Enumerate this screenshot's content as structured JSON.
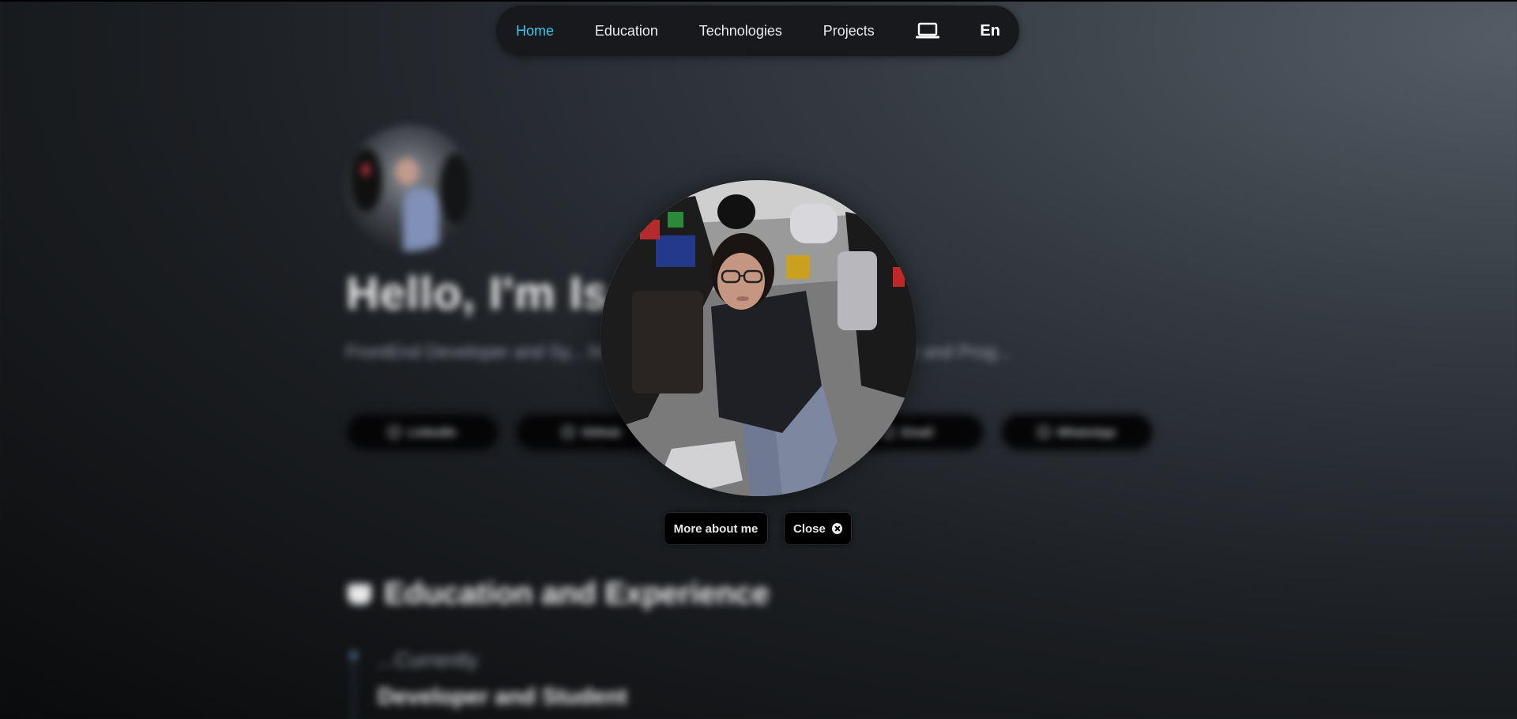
{
  "nav": {
    "items": [
      {
        "label": "Home",
        "active": true
      },
      {
        "label": "Education",
        "active": false
      },
      {
        "label": "Technologies",
        "active": false
      },
      {
        "label": "Projects",
        "active": false
      }
    ],
    "theme_icon": "laptop-icon",
    "language": "En",
    "accent_color": "#3cc6ea"
  },
  "background": {
    "hello": "Hello, I'm Is",
    "description": "FrontEnd Developer and Sy... Mexico. Contributing to the Development and Prog...",
    "socials": [
      "LinkedIn",
      "GitHub",
      "Email",
      "WhatsApp"
    ],
    "section_title": "Education and Experience",
    "timeline": {
      "date": "...Currently",
      "title": "Developer and Student"
    }
  },
  "modal": {
    "more_label": "More about me",
    "close_label": "Close"
  }
}
